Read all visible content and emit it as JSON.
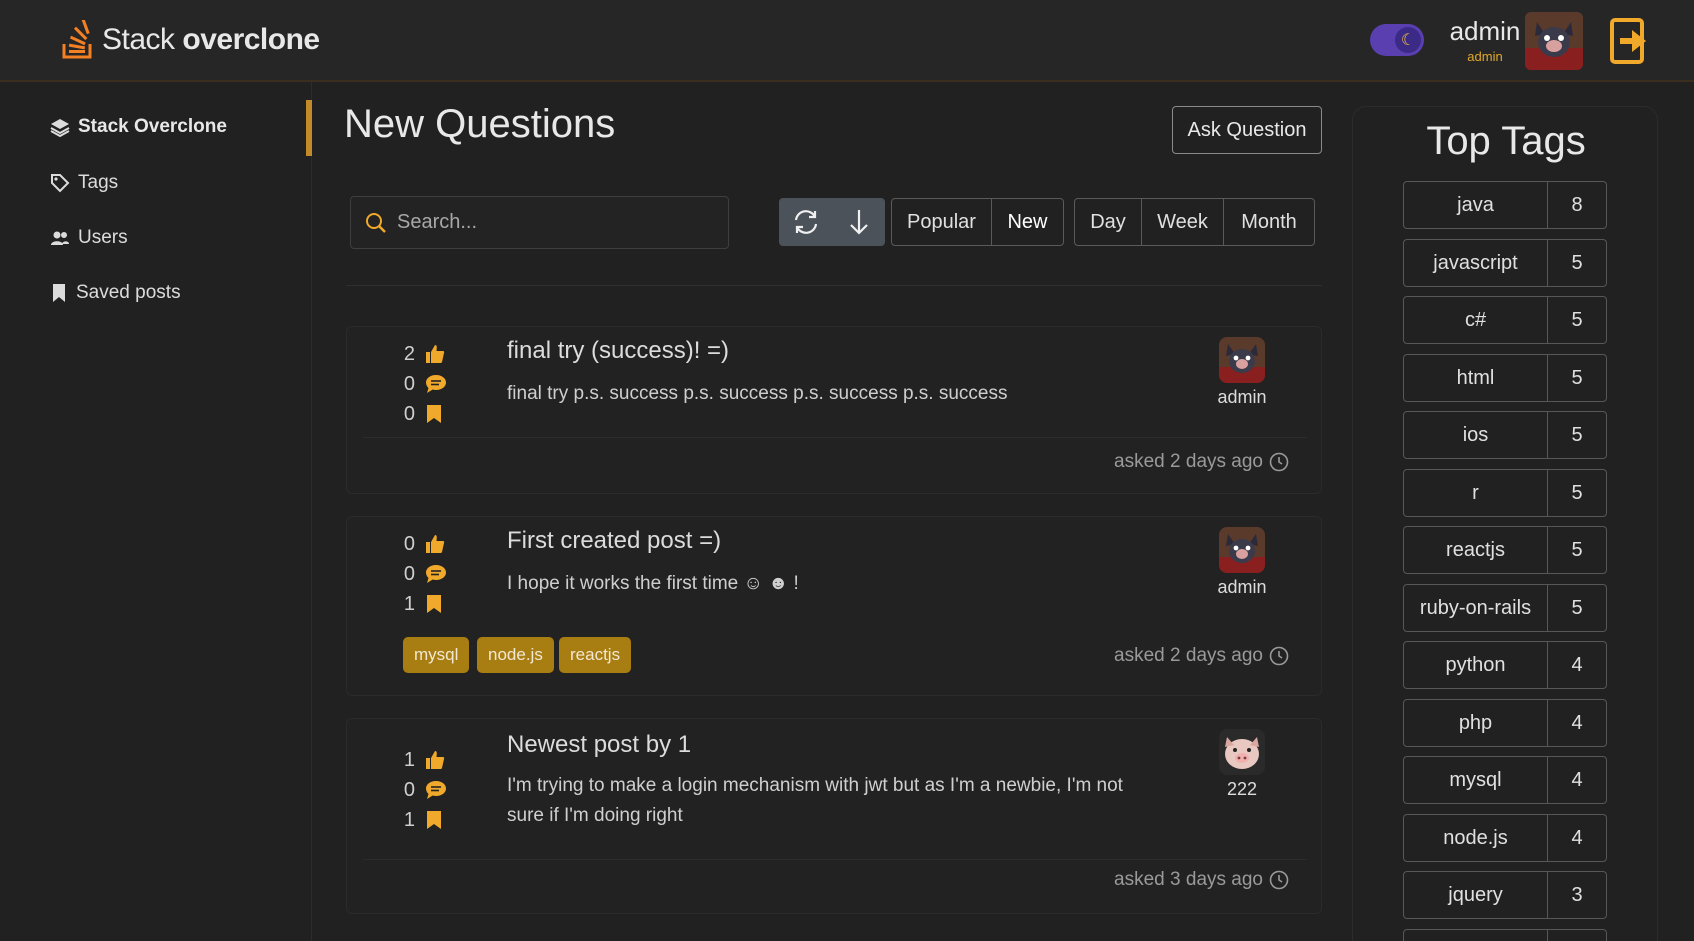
{
  "header": {
    "logo_light": "Stack ",
    "logo_bold": "overclone",
    "user_name": "admin",
    "user_role": "admin",
    "theme": "dark"
  },
  "sidebar": {
    "items": [
      {
        "label": "Stack Overclone",
        "icon": "layers-icon",
        "active": true
      },
      {
        "label": "Tags",
        "icon": "tag-icon",
        "active": false
      },
      {
        "label": "Users",
        "icon": "users-icon",
        "active": false
      },
      {
        "label": "Saved posts",
        "icon": "bookmark-icon",
        "active": false
      }
    ]
  },
  "main": {
    "title": "New Questions",
    "ask_button": "Ask Question",
    "search_placeholder": "Search...",
    "sort_buttons": [
      "Popular",
      "New"
    ],
    "sort_selected": "New",
    "period_buttons": [
      "Day",
      "Week",
      "Month"
    ]
  },
  "posts": [
    {
      "likes": "2",
      "comments": "0",
      "saves": "0",
      "title": "final try (success)! =)",
      "body": "final try p.s. success p.s. success p.s. success p.s. success",
      "author": "admin",
      "asked": "asked 2 days ago",
      "tags": []
    },
    {
      "likes": "0",
      "comments": "0",
      "saves": "1",
      "title": "First created post =)",
      "body": "I hope it works the first time ☺ ☻ !",
      "author": "admin",
      "asked": "asked 2 days ago",
      "tags": [
        "mysql",
        "node.js",
        "reactjs"
      ]
    },
    {
      "likes": "1",
      "comments": "0",
      "saves": "1",
      "title": "Newest post by 1",
      "body": "I'm trying to make a login mechanism with jwt but as I'm a newbie, I'm not sure if I'm doing right",
      "author": "222",
      "asked": "asked 3 days ago",
      "tags": []
    }
  ],
  "top_tags": {
    "title": "Top Tags",
    "items": [
      {
        "name": "java",
        "count": "8"
      },
      {
        "name": "javascript",
        "count": "5"
      },
      {
        "name": "c#",
        "count": "5"
      },
      {
        "name": "html",
        "count": "5"
      },
      {
        "name": "ios",
        "count": "5"
      },
      {
        "name": "r",
        "count": "5"
      },
      {
        "name": "reactjs",
        "count": "5"
      },
      {
        "name": "ruby-on-rails",
        "count": "5"
      },
      {
        "name": "python",
        "count": "4"
      },
      {
        "name": "php",
        "count": "4"
      },
      {
        "name": "mysql",
        "count": "4"
      },
      {
        "name": "node.js",
        "count": "4"
      },
      {
        "name": "jquery",
        "count": "3"
      }
    ]
  },
  "colors": {
    "accent": "#f0a92a",
    "tag_pill": "#a87d12",
    "toggle": "#5a3fb0"
  }
}
